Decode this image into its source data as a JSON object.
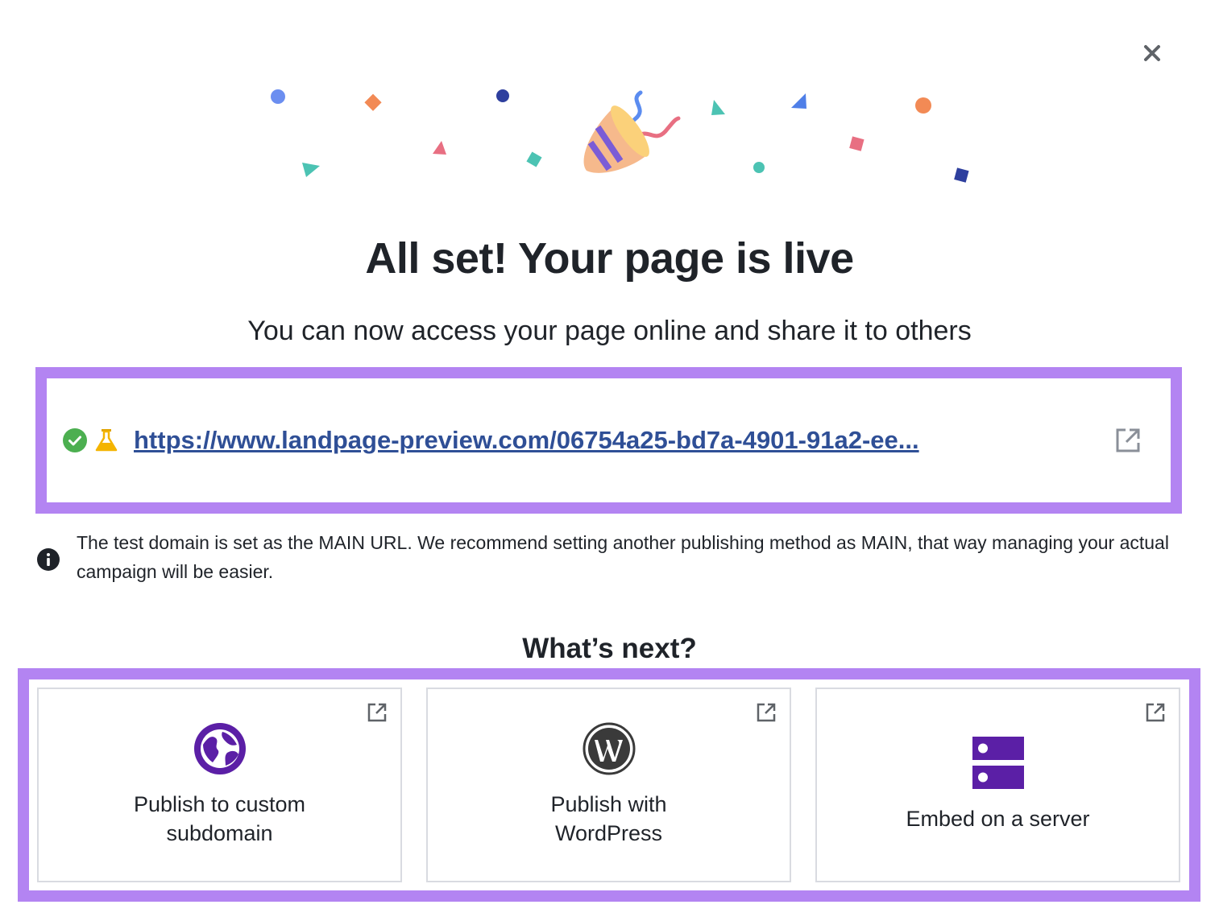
{
  "dialog": {
    "close_label": "×",
    "title": "All set! Your page is live",
    "subtitle": "You can now access your page online and share it to others"
  },
  "url_panel": {
    "status_icon": "check-circle-icon",
    "test_icon": "flask-icon",
    "url": "https://www.landpage-preview.com/06754a25-bd7a-4901-91a2-ee...",
    "open_icon": "external-link-icon",
    "highlight_color": "#b384f2"
  },
  "info": {
    "icon": "info-icon",
    "text": "The test domain is set as the MAIN URL. We recommend setting another publishing method as MAIN, that way managing your actual campaign will be easier."
  },
  "next": {
    "title": "What’s next?",
    "cards": [
      {
        "label": "Publish to custom subdomain",
        "icon": "globe-icon",
        "icon_color": "#5b1fa6"
      },
      {
        "label": "Publish with WordPress",
        "icon": "wordpress-icon",
        "icon_color": "#3a3a3a"
      },
      {
        "label": "Embed on a server",
        "icon": "server-icon",
        "icon_color": "#5b1fa6"
      }
    ]
  },
  "colors": {
    "accent_purple": "#b384f2",
    "link_blue": "#2f4f96",
    "success_green": "#4caf50",
    "flask_amber": "#f4b400"
  }
}
